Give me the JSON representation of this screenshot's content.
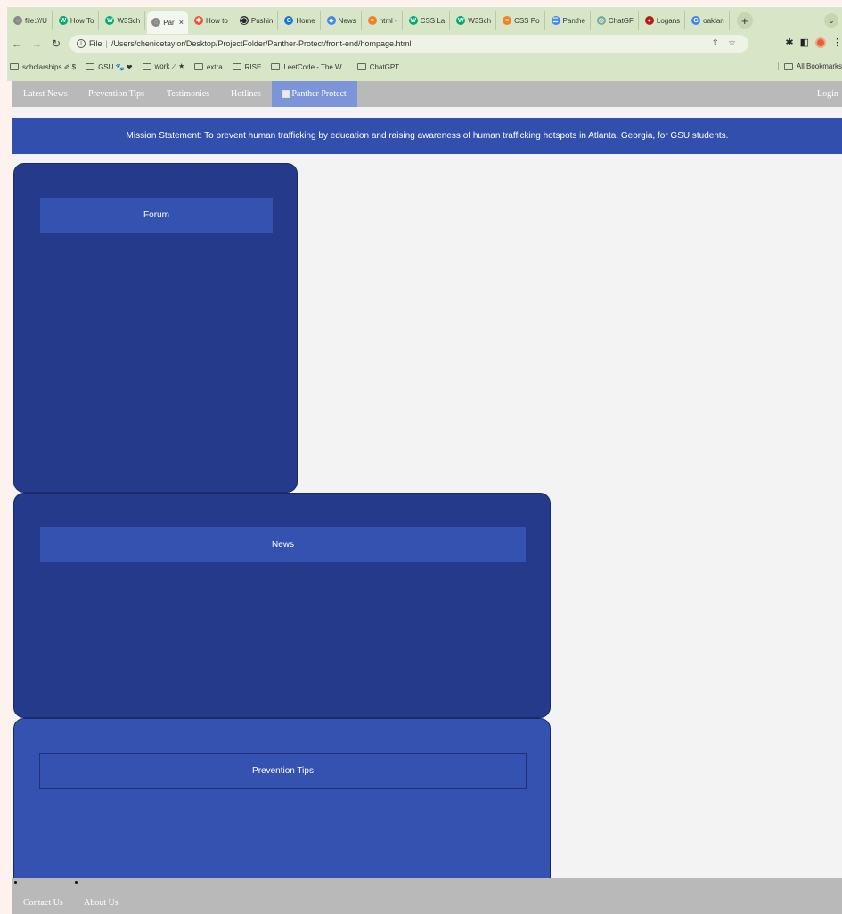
{
  "browser": {
    "tabs": [
      {
        "label": "file:///U",
        "fav_color": "#888888",
        "fav": "◌"
      },
      {
        "label": "How To",
        "fav_color": "#04aa6d",
        "fav": "W"
      },
      {
        "label": "W3Sch",
        "fav_color": "#04aa6d",
        "fav": "W"
      },
      {
        "label": "Par",
        "fav_color": "#888888",
        "fav": "◌",
        "active": true
      },
      {
        "label": "How to",
        "fav_color": "#f05033",
        "fav": "✱"
      },
      {
        "label": "Pushin",
        "fav_color": "#24292e",
        "fav": "◯"
      },
      {
        "label": "Home",
        "fav_color": "#1a73e8",
        "fav": "C"
      },
      {
        "label": "News",
        "fav_color": "#4285f4",
        "fav": "◆"
      },
      {
        "label": "html -",
        "fav_color": "#f48024",
        "fav": "≡"
      },
      {
        "label": "CSS La",
        "fav_color": "#04aa6d",
        "fav": "W"
      },
      {
        "label": "W3Sch",
        "fav_color": "#04aa6d",
        "fav": "W"
      },
      {
        "label": "CSS Po",
        "fav_color": "#f48024",
        "fav": "≡"
      },
      {
        "label": "Panthe",
        "fav_color": "#4285f4",
        "fav": "☰"
      },
      {
        "label": "ChatGF",
        "fav_color": "#74aa9c",
        "fav": "◎"
      },
      {
        "label": "Logans",
        "fav_color": "#b71c1c",
        "fav": "●"
      },
      {
        "label": "oaklan",
        "fav_color": "#4285f4",
        "fav": "G"
      }
    ],
    "new_tab_icon": "plus-icon",
    "url_scheme": "File",
    "url": "/Users/chenicetaylor/Desktop/ProjectFolder/Panther-Protect/front-end/hompage.html",
    "bookmarks": [
      {
        "label": "scholarships ✐ $"
      },
      {
        "label": "GSU 🐾 ❤"
      },
      {
        "label": "work ⟋ ★"
      },
      {
        "label": "extra"
      },
      {
        "label": "RISE"
      },
      {
        "label": "LeetCode - The W..."
      },
      {
        "label": "ChatGPT"
      }
    ],
    "all_bookmarks": "All Bookmarks"
  },
  "nav": {
    "latest_news": "Latest News",
    "prevention_tips": "Prevention Tips",
    "testimonies": "Testimonies",
    "hotlines": "Hotlines",
    "brand": "Panther Protect",
    "login": "Login"
  },
  "mission": "Mission Statement: To prevent human trafficking by education and raising awareness of human trafficking hotspots in Atlanta, Georgia, for GSU students.",
  "cards": {
    "forum": "Forum",
    "news": "News",
    "prevention": "Prevention Tips"
  },
  "footer": {
    "contact": "Contact Us",
    "about": "About Us"
  },
  "colors": {
    "nav_bg": "#b9b9b9",
    "brand_bg": "#7b95d8",
    "mission_bg": "#3150ad",
    "card_dark": "#253a8b",
    "card_light": "#3452b0",
    "page_bg": "#f3f3f3"
  }
}
